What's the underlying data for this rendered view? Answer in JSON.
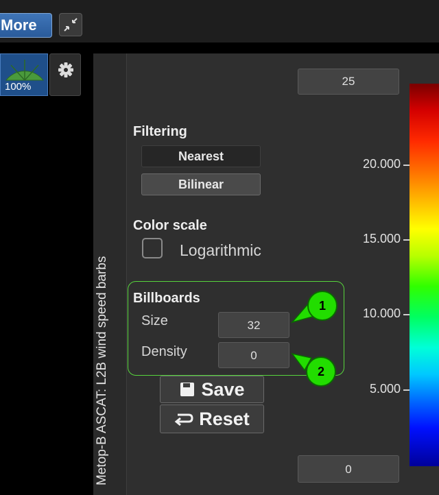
{
  "toolbar": {
    "more_label": "More"
  },
  "layer": {
    "percent": "100%"
  },
  "panel": {
    "title": "Metop-B ASCAT: L2B wind speed barbs",
    "range_max": "25",
    "range_min": "0",
    "filtering": {
      "title": "Filtering",
      "options": [
        "Nearest",
        "Bilinear"
      ],
      "selected": "Bilinear"
    },
    "color_scale": {
      "title": "Color scale",
      "logarithmic_label": "Logarithmic",
      "logarithmic_checked": false
    },
    "billboards": {
      "title": "Billboards",
      "size_label": "Size",
      "size_value": "32",
      "density_label": "Density",
      "density_value": "0"
    },
    "save_label": "Save",
    "reset_label": "Reset"
  },
  "colorbar": {
    "ticks": [
      "20.000",
      "15.000",
      "10.000",
      "5.000"
    ]
  },
  "callouts": [
    "1",
    "2"
  ]
}
